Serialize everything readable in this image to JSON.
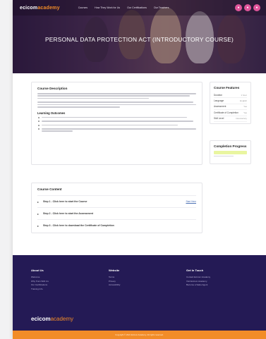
{
  "header": {
    "logo_main": "ecicom",
    "logo_accent": "academy",
    "nav": [
      "Courses",
      "How They Work for Us",
      "Our Certifications",
      "Our Teachers"
    ],
    "title": "PERSONAL DATA PROTECTION ACT (INTRODUCTORY COURSE)"
  },
  "description": {
    "heading": "Course Description",
    "learning_heading": "Learning Outcomes"
  },
  "features": {
    "heading": "Course Features",
    "rows": [
      {
        "k": "Duration",
        "v": "1 hour"
      },
      {
        "k": "Language",
        "v": "English"
      },
      {
        "k": "Assessment",
        "v": "Yes"
      },
      {
        "k": "Certificate of Completion",
        "v": "Yes"
      },
      {
        "k": "Skill Level",
        "v": "Introductory"
      }
    ]
  },
  "progress": {
    "heading": "Completion Progress",
    "value": 0
  },
  "content": {
    "heading": "Course Content",
    "steps": [
      {
        "label": "Step 1 - Click here to start the Course",
        "link": "Start Here"
      },
      {
        "label": "Step 2 - Click here to start the Assessment",
        "link": ""
      },
      {
        "label": "Step 3 - Click here to download the Certificate of Completion",
        "link": ""
      }
    ]
  },
  "footer": {
    "col1": {
      "heading": "About Us",
      "items": [
        "Welcome",
        "Why Train With Us",
        "Our Certifications",
        "Training Info"
      ]
    },
    "col2": {
      "heading": "Website",
      "items": [
        "Terms",
        "Privacy",
        "Accessibility"
      ]
    },
    "col3": {
      "heading": "Get In Touch",
      "items": [
        "Contact Ecicom Academy",
        "Visit Ecicom Academy",
        "Become a Sales Agent"
      ]
    },
    "logo_main": "ecicom",
    "logo_accent": "academy",
    "copyright": "Copyright © 2021 Ecicom Academy. All rights reserved."
  },
  "colors": {
    "accent": "#f28c28",
    "footer_bg": "#241a55",
    "nav_button": "#e0559b",
    "progress": "#e9f5a0"
  }
}
